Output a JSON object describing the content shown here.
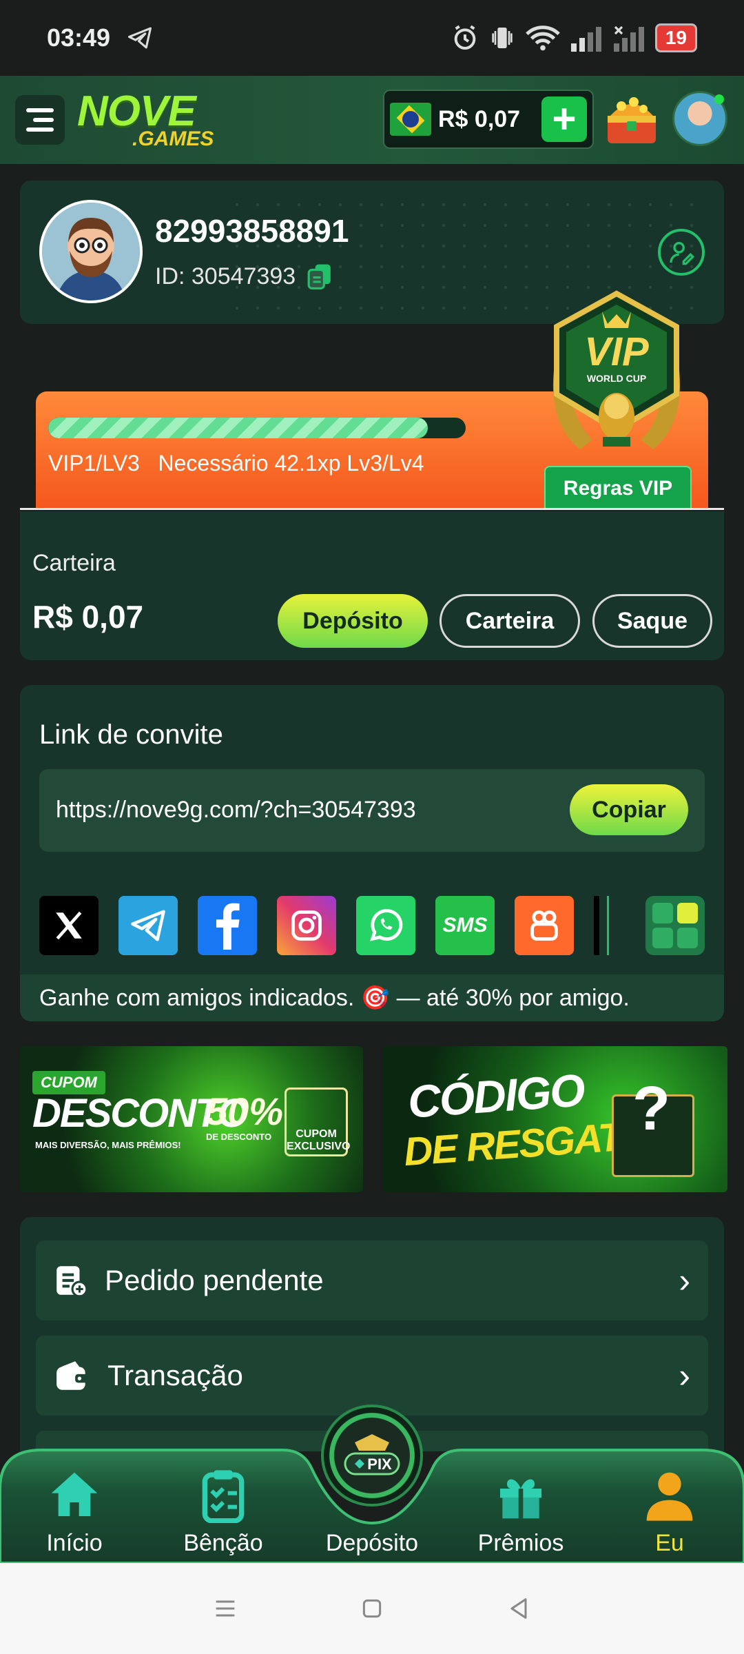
{
  "status_bar": {
    "time": "03:49",
    "battery": "19"
  },
  "header": {
    "logo_main": "NOVE",
    "logo_sub": ".GAMES",
    "flag": "brazil-flag",
    "balance": "R$ 0,07",
    "add_symbol": "+"
  },
  "profile": {
    "username": "82993858891",
    "id_text": "ID: 30547393"
  },
  "vip": {
    "level_text": "VIP1/LV3",
    "needed_text": "Necessário 42.1xp Lv3/Lv4",
    "progress": 0.91,
    "rules_label": "Regras VIP",
    "badge_title": "VIP",
    "badge_sub": "WORLD CUP"
  },
  "wallet": {
    "label": "Carteira",
    "amount": "R$ 0,07",
    "buttons": {
      "deposit": "Depósito",
      "wallet": "Carteira",
      "withdraw": "Saque"
    }
  },
  "invite": {
    "title": "Link de convite",
    "url": "https://nove9g.com/?ch=30547393",
    "copy_label": "Copiar",
    "socials": [
      "x-icon",
      "telegram-icon",
      "facebook-icon",
      "instagram-icon",
      "whatsapp-icon",
      "sms-icon",
      "kwai-icon"
    ],
    "footer": "Ganhe com amigos indicados. 🎯 — até 30% por amigo."
  },
  "banners": {
    "b1": {
      "tag": "CUPOM",
      "title": "DESCONTO",
      "sub": "MAIS DIVERSÃO, MAIS PRÊMIOS!",
      "percent": "50%",
      "percent_sub": "DE DESCONTO",
      "coupon": "CUPOM EXCLUSIVO"
    },
    "b2": {
      "line1": "CÓDIGO",
      "line2": "DE RESGATE"
    }
  },
  "menu": [
    {
      "label": "Pedido pendente"
    },
    {
      "label": "Transação"
    }
  ],
  "bottom_nav": {
    "tabs": [
      "Início",
      "Bênção",
      "Depósito",
      "Prêmios",
      "Eu"
    ],
    "active": "Eu",
    "pix_label": "PIX"
  },
  "colors": {
    "accent": "#22c06a",
    "card": "#17352a",
    "vip_orange": "#f4571d",
    "active_tab": "#f0e53a"
  }
}
